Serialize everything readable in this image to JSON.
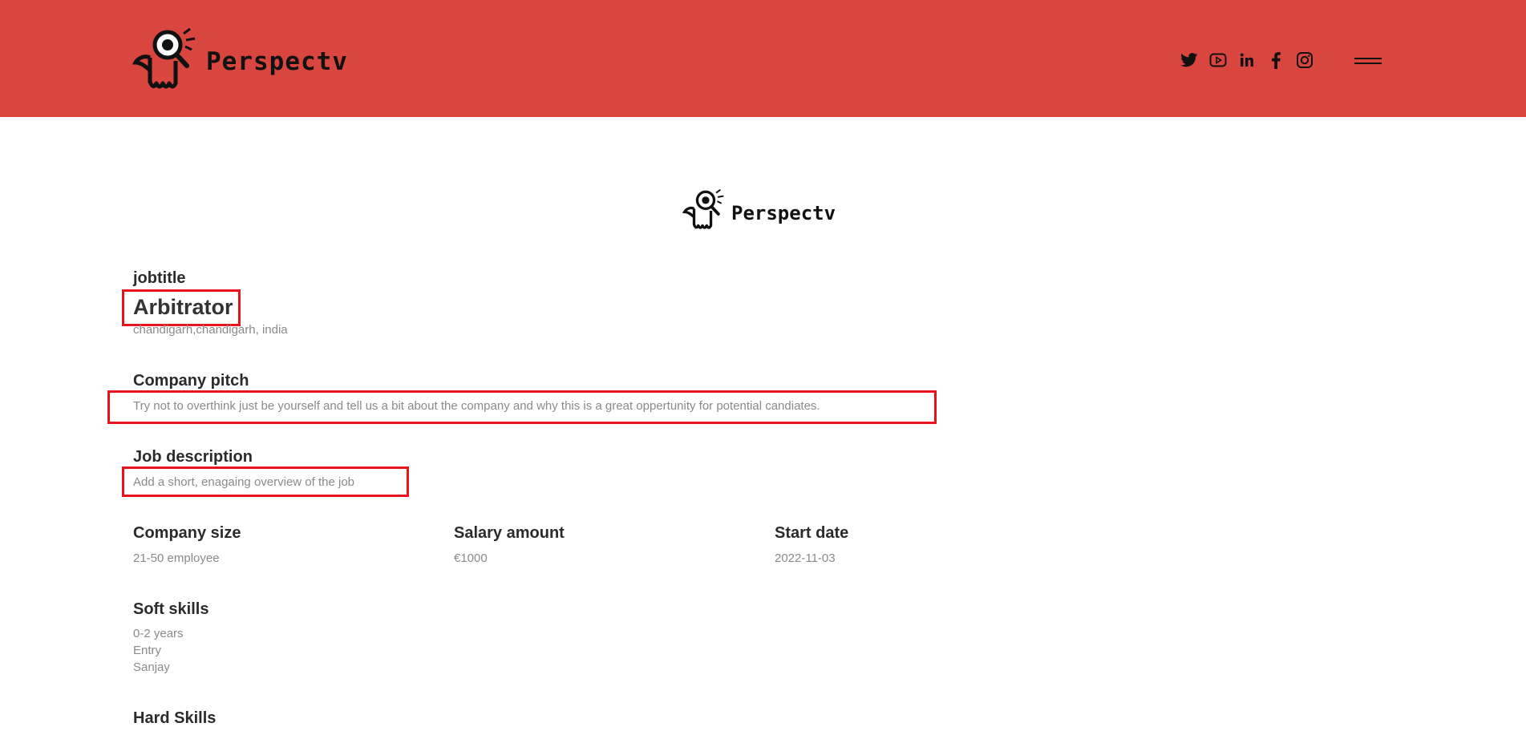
{
  "header": {
    "brand_name": "Perspectv",
    "socials": [
      {
        "icon": "twitter-icon"
      },
      {
        "icon": "youtube-icon"
      },
      {
        "icon": "linkedin-icon"
      },
      {
        "icon": "facebook-icon"
      },
      {
        "icon": "instagram-icon"
      }
    ],
    "menu_icon": "hamburger-menu-icon",
    "background_color": "#d9453f"
  },
  "card": {
    "logo_name": "Perspectv",
    "jobtitle_label": "jobtitle",
    "job_title": "Arbitrator",
    "location": "chandigarh,chandigarh, india",
    "company_pitch_label": "Company pitch",
    "company_pitch": "Try not to overthink just be yourself and tell us a bit about the company and why this is a great oppertunity for potential candiates.",
    "job_description_label": "Job description",
    "job_description": "Add a short, enagaing overview of the job",
    "company_size_label": "Company size",
    "company_size": "21-50 employee",
    "salary_label": "Salary amount",
    "salary": "€1000",
    "start_date_label": "Start date",
    "start_date": "2022-11-03",
    "soft_skills_label": "Soft skills",
    "soft_skills": [
      "0-2 years",
      "Entry",
      "Sanjay"
    ],
    "hard_skills_label": "Hard Skills"
  },
  "highlight_color": "#e8141c"
}
